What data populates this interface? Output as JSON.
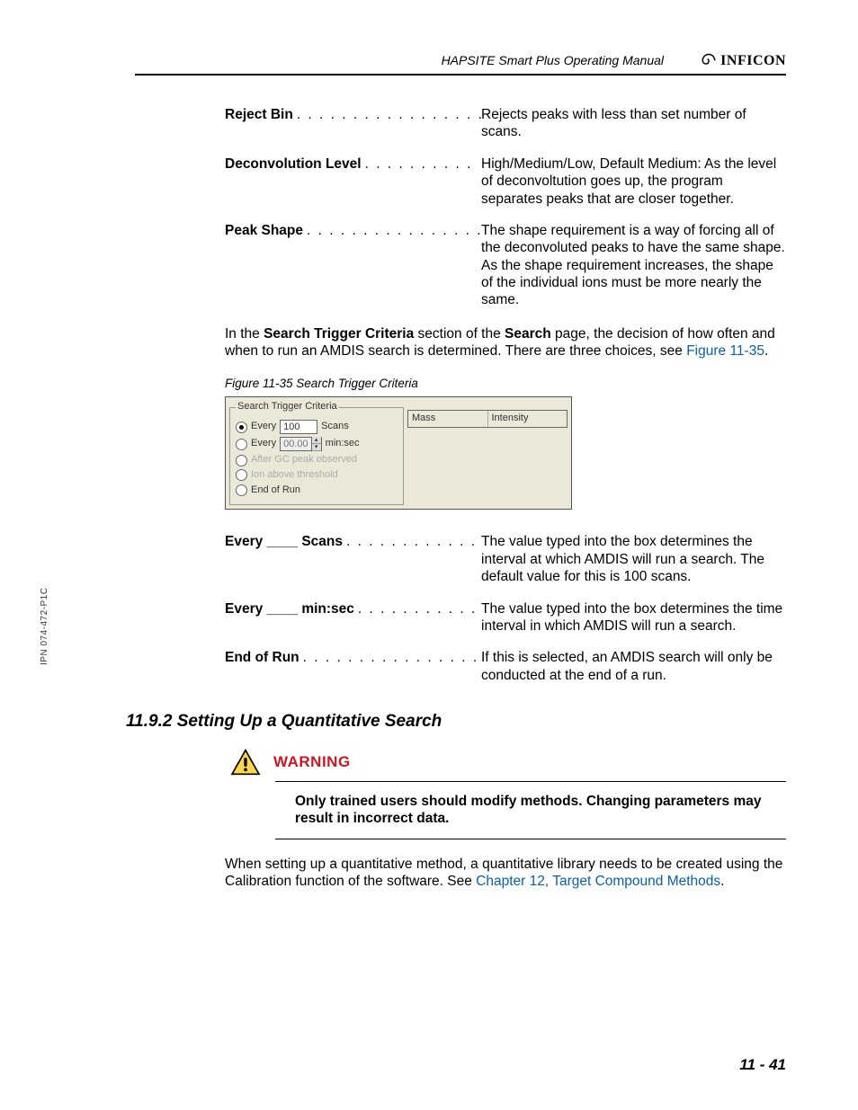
{
  "header": {
    "manual_title": "HAPSITE Smart Plus Operating Manual",
    "brand": "INFICON"
  },
  "side_ipn": "IPN 074-472-P1C",
  "definitions_top": [
    {
      "term": "Reject Bin",
      "leaders": ". . . . . . . . . . . . . . . . . . . .",
      "desc": "Rejects peaks with less than set number of scans."
    },
    {
      "term": "Deconvolution Level",
      "leaders": " . . . . . . . . . .",
      "desc": "High/Medium/Low, Default Medium: As the level of deconvoltution goes up, the program separates peaks that are closer together."
    },
    {
      "term": "Peak Shape",
      "leaders": ". . . . . . . . . . . . . . . . . . .",
      "desc": "The shape requirement is a way of forcing all of the deconvoluted peaks to have the same shape. As the shape requirement increases, the shape of the individual ions must be more nearly the same."
    }
  ],
  "para1": {
    "pre": "In the ",
    "b1": "Search Trigger Criteria",
    "mid": " section of the ",
    "b2": "Search",
    "tail": " page, the decision of how often and when to run an AMDIS search is determined. There are three choices, see ",
    "link": "Figure 11-35",
    "end": "."
  },
  "figure": {
    "caption": "Figure 11-35  Search Trigger Criteria",
    "group_label": "Search Trigger Criteria",
    "opts": {
      "every_scans_label": "Every",
      "every_scans_value": "100",
      "every_scans_suffix": "Scans",
      "every_minsec_label": "Every",
      "every_minsec_value": "00.00",
      "every_minsec_suffix": "min:sec",
      "after_gc": "After GC peak observed",
      "ion_above": "Ion above threshold",
      "end_of_run": "End of Run"
    },
    "table_headers": [
      "Mass",
      "Intensity"
    ]
  },
  "definitions_bottom": [
    {
      "term": "Every ____ Scans",
      "leaders": ". . . . . . . . . . . . . .",
      "desc": "The value typed into the box determines the interval at which AMDIS will run a search. The default value for this is 100 scans."
    },
    {
      "term": "Every ____ min:sec",
      "leaders": " . . . . . . . . . . .",
      "desc": "The value typed into the box determines the time interval in which AMDIS will run a search."
    },
    {
      "term": "End of Run",
      "leaders": " . . . . . . . . . . . . . . . . . .",
      "desc": "If this is selected, an AMDIS search will only be conducted at the end of a run."
    }
  ],
  "section_heading": "11.9.2  Setting Up a Quantitative Search",
  "warning": {
    "label": "WARNING",
    "text": "Only trained users should modify methods. Changing parameters may result in incorrect data."
  },
  "para2": {
    "pre": "When setting up a quantitative method, a quantitative library needs to be created using the Calibration function of the software. See ",
    "link": "Chapter 12, Target Compound Methods",
    "end": "."
  },
  "page_number": "11 - 41"
}
